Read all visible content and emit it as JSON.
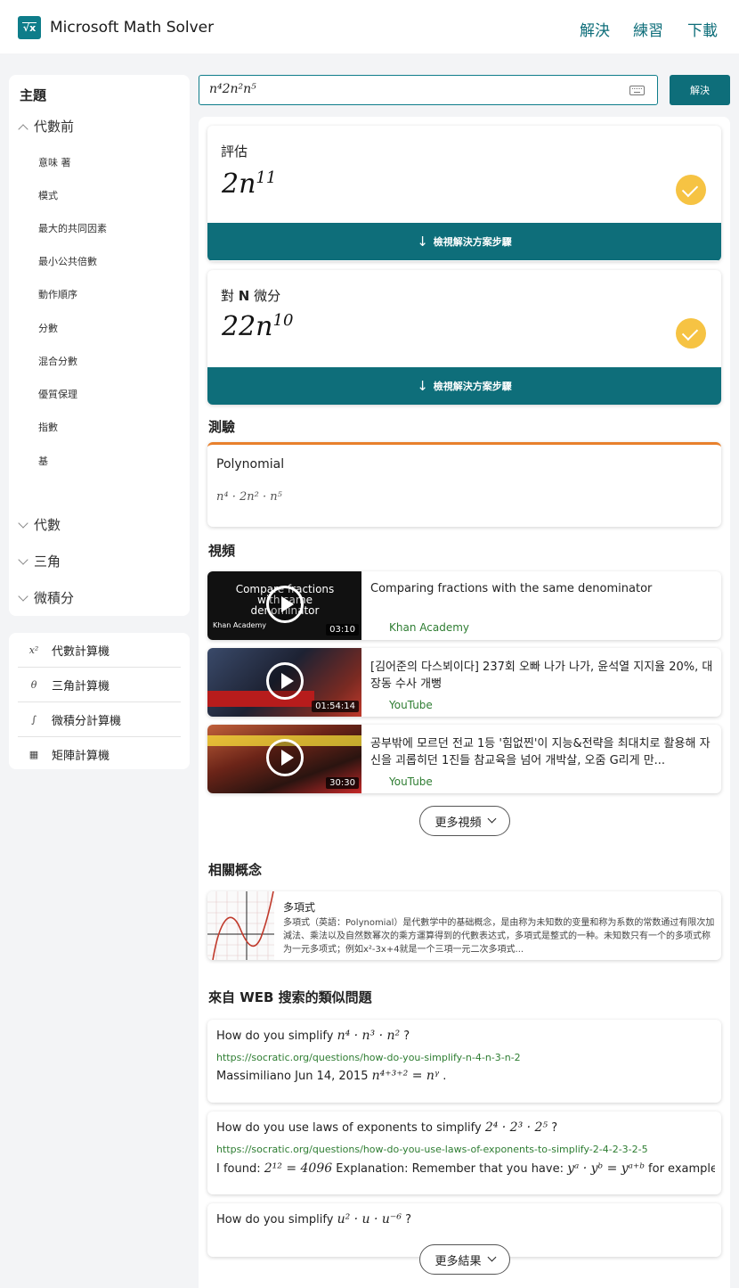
{
  "header": {
    "app_title": "Microsoft Math Solver",
    "logo_glyph": "√x",
    "nav": [
      "解決",
      "練習",
      "下載"
    ]
  },
  "sidebar": {
    "heading": "主題",
    "expanded_section": "代數前",
    "topics": [
      "意味 著",
      "模式",
      "最大的共同因素",
      "最小公共倍數",
      "動作順序",
      "分數",
      "混合分數",
      "優質保理",
      "指數",
      "基"
    ],
    "collapsed_sections": [
      "代數",
      "三角",
      "微積分"
    ],
    "calculators": [
      {
        "icon": "x²",
        "label": "代數計算機"
      },
      {
        "icon": "θ",
        "label": "三角計算機"
      },
      {
        "icon": "∫",
        "label": "微積分計算機"
      },
      {
        "icon": "▦",
        "label": "矩陣計算機"
      }
    ]
  },
  "search": {
    "value": "n⁴2n²n⁵",
    "button": "解決"
  },
  "results": [
    {
      "title": "評估",
      "base": "2n",
      "exp": "11",
      "steps_label": "檢視解決方案步驟"
    },
    {
      "title_pre": "對 ",
      "title_var": "N",
      "title_post": " 微分",
      "base": "22n",
      "exp": "10",
      "steps_label": "檢視解決方案步驟"
    }
  ],
  "quiz": {
    "section_title": "測驗",
    "title": "Polynomial",
    "expression": "n⁴ · 2n² · n⁵"
  },
  "videos": {
    "section_title": "視頻",
    "items": [
      {
        "title": "Comparing fractions with the same denominator",
        "source": "Khan Academy",
        "duration": "03:10",
        "thumb_text": "Compare fractions with same denominator",
        "thumb_brand": "Khan Academy"
      },
      {
        "title": "[김어준의 다스뵈이다] 237회 오빠 나가 나가, 윤석열 지지율 20%, 대장동 수사 개뻥",
        "source": "YouTube",
        "duration": "01:54:14"
      },
      {
        "title": "공부밖에 모르던 전교 1등 '힘없찐'이 지능&전략을 최대치로 활용해 자신을 괴롭히던 1진들 참교육을 넘어 개박살, 오줌 G리게 만...",
        "source": "YouTube",
        "duration": "30:30"
      }
    ],
    "more_label": "更多視頻"
  },
  "concepts": {
    "section_title": "相關概念",
    "item_title": "多項式",
    "item_desc": "多項式（英語：Polynomial）是代數学中的基础概念，是由称为未知数的变量和称为系数的常数通过有限次加減法、乘法以及自然数幂次的乘方運算得到的代數表达式，多項式是整式的一种。未知数只有一个的多项式称为一元多项式；例如x²-3x+4就是一个三項一元二次多項式..."
  },
  "web": {
    "section_title": "來自 WEB 搜索的類似問題",
    "items": [
      {
        "q_text": "How do you simplify ",
        "q_math": "n⁴ · n³ · n²",
        "q_end": " ?",
        "url": "https://socratic.org/questions/how-do-you-simplify-n-4-n-3-n-2",
        "a_text": "Massimiliano Jun 14, 2015 ",
        "a_math": "n⁴⁺³⁺² = nᵞ",
        "a_end": " ."
      },
      {
        "q_text": "How do you use laws of exponents to simplify ",
        "q_math": "2⁴ · 2³ · 2⁵",
        "q_end": " ?",
        "url": "https://socratic.org/questions/how-do-you-use-laws-of-exponents-to-simplify-2-4-2-3-2-5",
        "a_text": "I found: ",
        "a_math": "2¹² = 4096",
        "a_end": " Explanation: Remember that you have: ",
        "a_math2": "yᵃ · yᵇ = yᵃ⁺ᵇ",
        "a_end2": " for example if yo"
      },
      {
        "q_text": "How do you simplify ",
        "q_math": "u² · u · u⁻⁶",
        "q_end": " ?"
      }
    ],
    "more_label": "更多結果"
  },
  "colors": {
    "accent": "#0e6e7a",
    "check": "#f6c343",
    "quiz_border": "#e8802c",
    "source_green": "#2e7d32"
  }
}
